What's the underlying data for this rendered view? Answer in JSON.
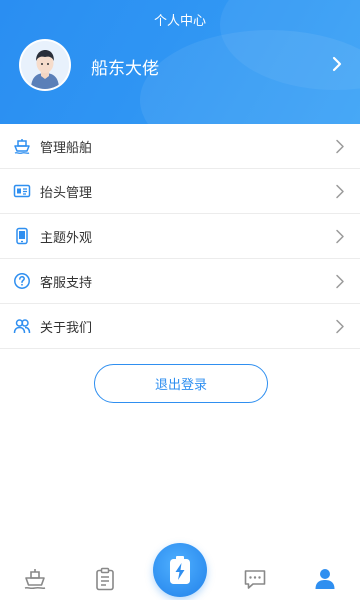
{
  "header": {
    "title": "个人中心",
    "username": "船东大佬"
  },
  "menu": [
    {
      "label": "管理船舶",
      "icon": "ship-icon"
    },
    {
      "label": "抬头管理",
      "icon": "id-card-icon"
    },
    {
      "label": "主题外观",
      "icon": "phone-icon"
    },
    {
      "label": "客服支持",
      "icon": "help-circle-icon"
    },
    {
      "label": "关于我们",
      "icon": "users-icon"
    }
  ],
  "logout": {
    "label": "退出登录"
  },
  "tabbar": {
    "tabs": [
      {
        "icon": "ship-tab-icon"
      },
      {
        "icon": "clipboard-icon"
      },
      {
        "icon": "charge-icon"
      },
      {
        "icon": "message-icon"
      },
      {
        "icon": "user-icon",
        "active": true
      }
    ]
  },
  "colors": {
    "accent": "#2f8ff0",
    "tab_inactive": "#888888",
    "header_bg": "#2a8ef2"
  }
}
